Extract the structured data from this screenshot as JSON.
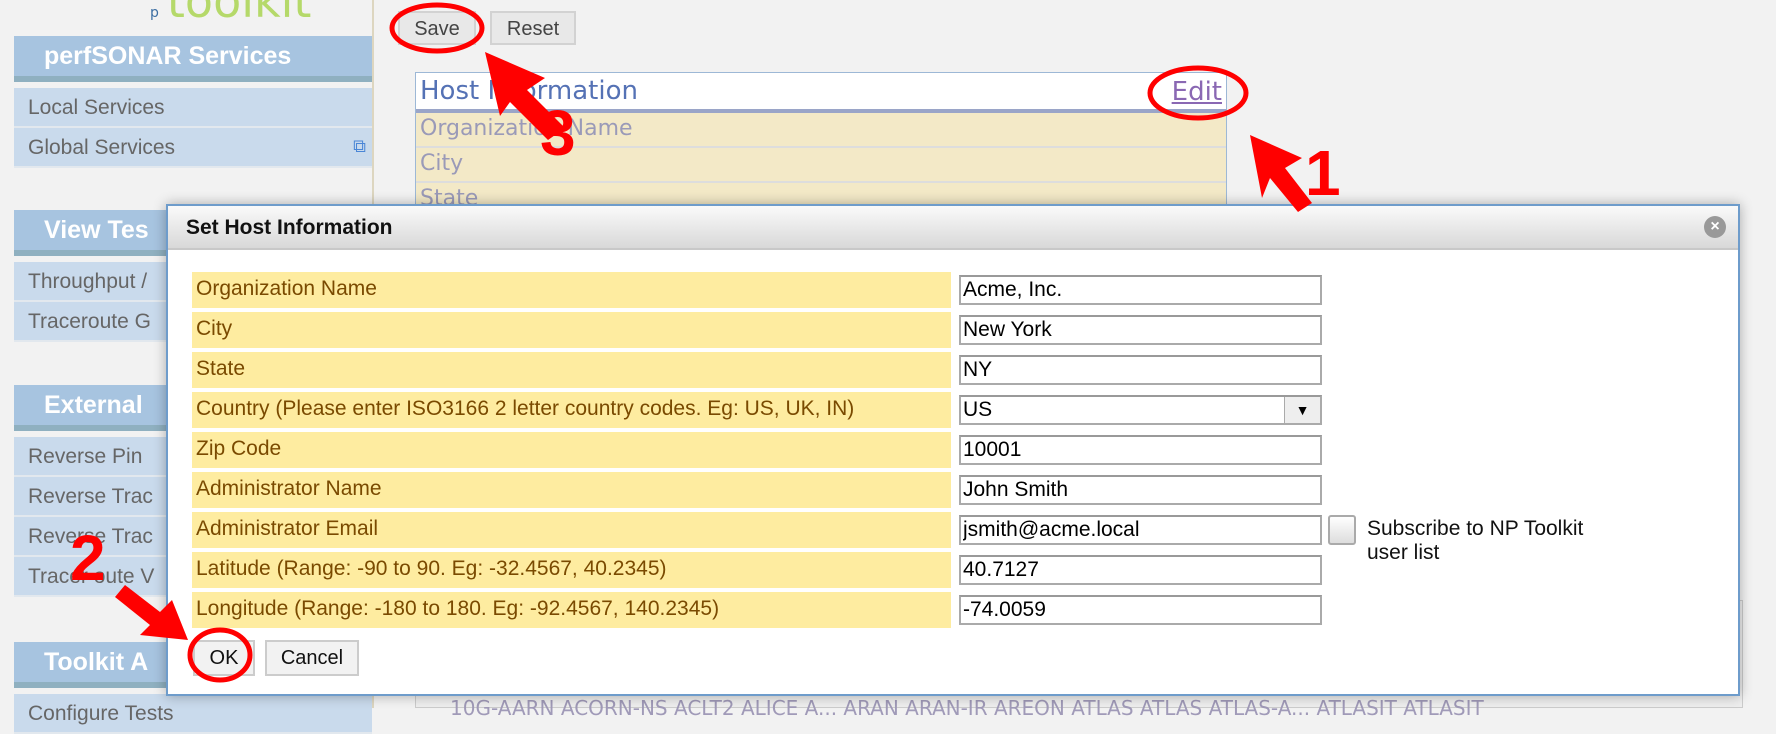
{
  "logo": {
    "prefix": "p",
    "text": "toolkit"
  },
  "sidebar": {
    "sections": [
      {
        "title": "perfSONAR Services",
        "items": [
          "Local Services",
          "Global Services"
        ]
      },
      {
        "title": "View Tes",
        "items": [
          "Throughput /",
          "Traceroute G"
        ]
      },
      {
        "title": "External",
        "items": [
          "Reverse Pin",
          "Reverse Trac",
          "Reverse Trac",
          "Tracer oute V"
        ]
      },
      {
        "title": "Toolkit A",
        "items": [
          "Configure Tests"
        ]
      }
    ],
    "external_link_icon": "external-link-icon"
  },
  "toolbar": {
    "save_label": "Save",
    "reset_label": "Reset"
  },
  "host_panel": {
    "title": "Host Information",
    "edit_label": "Edit",
    "rows": [
      "Organization Name",
      "City",
      "State"
    ]
  },
  "background_text": "10G-AARN  ACORN-NS  ACLT2  ALICE  A...  ARAN  ARAN-IR  AREON  ATLAS  ATLAS  ATLAS-A...  ATLASIT  ATLASIT",
  "dialog": {
    "title": "Set Host Information",
    "close_icon": "close-circle-icon",
    "fields": [
      {
        "label": "Organization Name",
        "value": "Acme, Inc."
      },
      {
        "label": "City",
        "value": "New York"
      },
      {
        "label": "State",
        "value": "NY"
      },
      {
        "label": "Country (Please enter ISO3166 2 letter country codes. Eg: US, UK, IN)",
        "value": "US"
      },
      {
        "label": "Zip Code",
        "value": "10001"
      },
      {
        "label": "Administrator Name",
        "value": "John Smith"
      },
      {
        "label": "Administrator Email",
        "value": "jsmith@acme.local"
      },
      {
        "label": "Latitude (Range: -90 to 90. Eg: -32.4567, 40.2345)",
        "value": "40.7127"
      },
      {
        "label": "Longitude (Range: -180 to 180. Eg: -92.4567, 140.2345)",
        "value": "-74.0059"
      }
    ],
    "subscribe_label": "Subscribe to NP Toolkit user list",
    "subscribe_checked": false,
    "ok_label": "OK",
    "cancel_label": "Cancel"
  },
  "annotations": {
    "color": "#ff0000",
    "steps": [
      "1",
      "2",
      "3"
    ]
  }
}
